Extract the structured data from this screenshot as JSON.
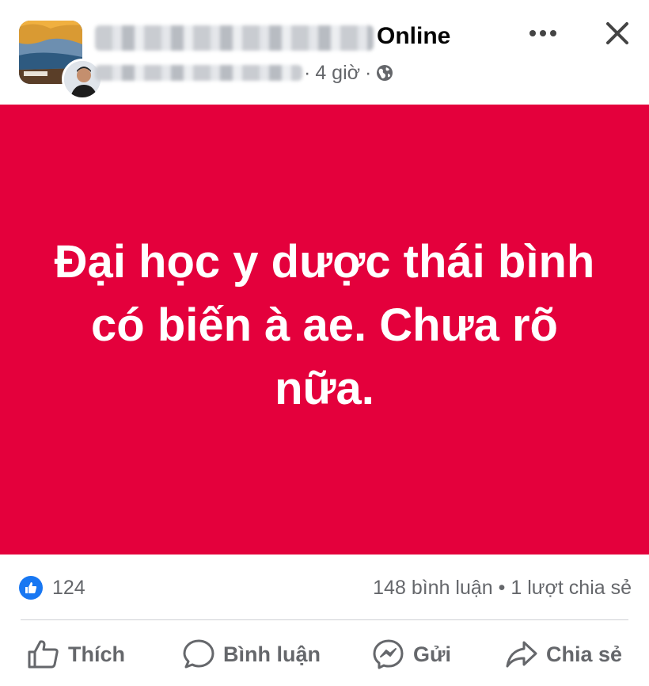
{
  "post": {
    "status": "Online",
    "time": "4 giờ",
    "meta_separator": "·",
    "body": "Đại học y dược thái bình có biến à ae. Chưa rõ nữa."
  },
  "stats": {
    "likes": "124",
    "comments": "148 bình luận",
    "separator": "•",
    "shares": "1 lượt chia sẻ"
  },
  "actions": {
    "like": "Thích",
    "comment": "Bình luận",
    "send": "Gửi",
    "share": "Chia sẻ"
  },
  "icons": {
    "privacy": "globe-icon",
    "more": "more-icon",
    "close": "close-icon",
    "reaction": "like-reaction-icon"
  },
  "colors": {
    "post_background": "#e4003c",
    "reaction_blue": "#1877f2",
    "secondary_text": "#65676b"
  }
}
